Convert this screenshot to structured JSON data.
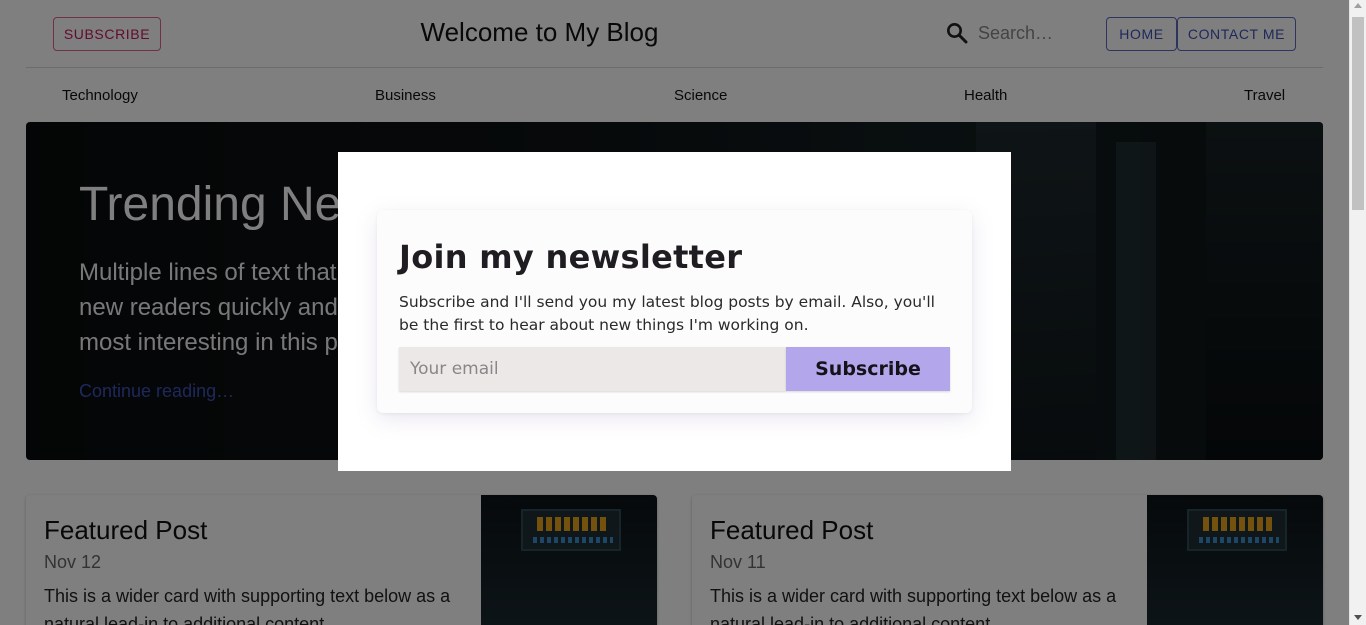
{
  "header": {
    "subscribe_label": "SUBSCRIBE",
    "title": "Welcome to My Blog",
    "search_placeholder": "Search…",
    "nav": {
      "home_label": "HOME",
      "contact_label": "CONTACT ME"
    }
  },
  "categories": [
    "Technology",
    "Business",
    "Science",
    "Health",
    "Travel"
  ],
  "hero": {
    "title": "Trending News",
    "text": "Multiple lines of text that form the lede, informing\nnew readers quickly and efficiently about what's\nmost interesting in this post's contents.",
    "link": "Continue reading…"
  },
  "cards": [
    {
      "title": "Featured Post",
      "date": "Nov 12",
      "text": "This is a wider card with supporting text below as a natural lead-in to additional content."
    },
    {
      "title": "Featured Post",
      "date": "Nov 11",
      "text": "This is a wider card with supporting text below as a natural lead-in to additional content."
    }
  ],
  "newsletter": {
    "title": "Join my newsletter",
    "description": "Subscribe and I'll send you my latest blog posts by email. Also, you'll be the first to hear about new things I'm working on.",
    "email_placeholder": "Your email",
    "button_label": "Subscribe",
    "button_color": "#b3a6eb"
  },
  "colors": {
    "subscribe_accent": "#c2185b",
    "nav_accent": "#3f51b5",
    "overlay": "rgba(0,0,0,0.5)"
  }
}
